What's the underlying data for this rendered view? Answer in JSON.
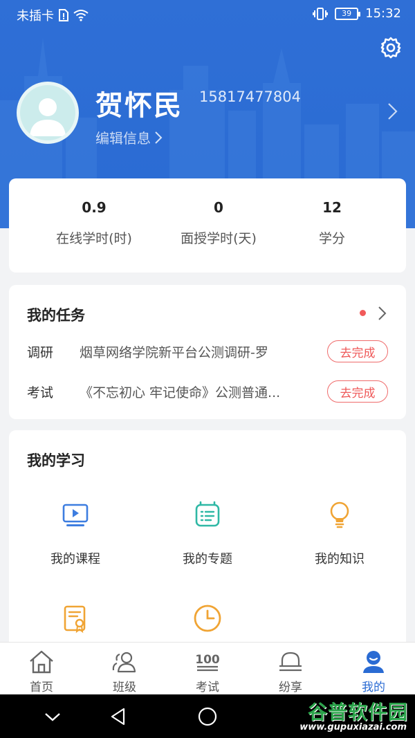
{
  "status_bar": {
    "carrier": "未插卡",
    "battery": "39",
    "time": "15:32"
  },
  "profile": {
    "name": "贺怀民",
    "phone": "15817477804",
    "edit_label": "编辑信息"
  },
  "stats": [
    {
      "value": "0.9",
      "label": "在线学时(时)"
    },
    {
      "value": "0",
      "label": "面授学时(天)"
    },
    {
      "value": "12",
      "label": "学分"
    }
  ],
  "tasks": {
    "title": "我的任务",
    "items": [
      {
        "type": "调研",
        "name": "烟草网络学院新平台公测调研-罗",
        "action": "去完成"
      },
      {
        "type": "考试",
        "name": "《不忘初心 牢记使命》公测普通...",
        "action": "去完成"
      }
    ]
  },
  "study": {
    "title": "我的学习",
    "items": [
      {
        "label": "我的课程",
        "icon": "video-course-icon"
      },
      {
        "label": "我的专题",
        "icon": "topic-icon"
      },
      {
        "label": "我的知识",
        "icon": "lightbulb-icon"
      },
      {
        "label": "",
        "icon": "certificate-icon"
      },
      {
        "label": "",
        "icon": "clock-icon"
      }
    ]
  },
  "tabs": [
    {
      "label": "首页",
      "icon": "home-icon"
    },
    {
      "label": "班级",
      "icon": "class-icon"
    },
    {
      "label": "考试",
      "icon": "exam-100-icon"
    },
    {
      "label": "纷享",
      "icon": "bell-share-icon"
    },
    {
      "label": "我的",
      "icon": "profile-icon"
    }
  ],
  "watermark": {
    "title": "谷普软件园",
    "url": "www.gupuxiazai.com"
  },
  "colors": {
    "primary": "#2a6bd3",
    "danger": "#ef5858",
    "course_icon": "#3d7de0",
    "topic_icon": "#2fb8a5",
    "knowledge_icon": "#f0a434"
  }
}
